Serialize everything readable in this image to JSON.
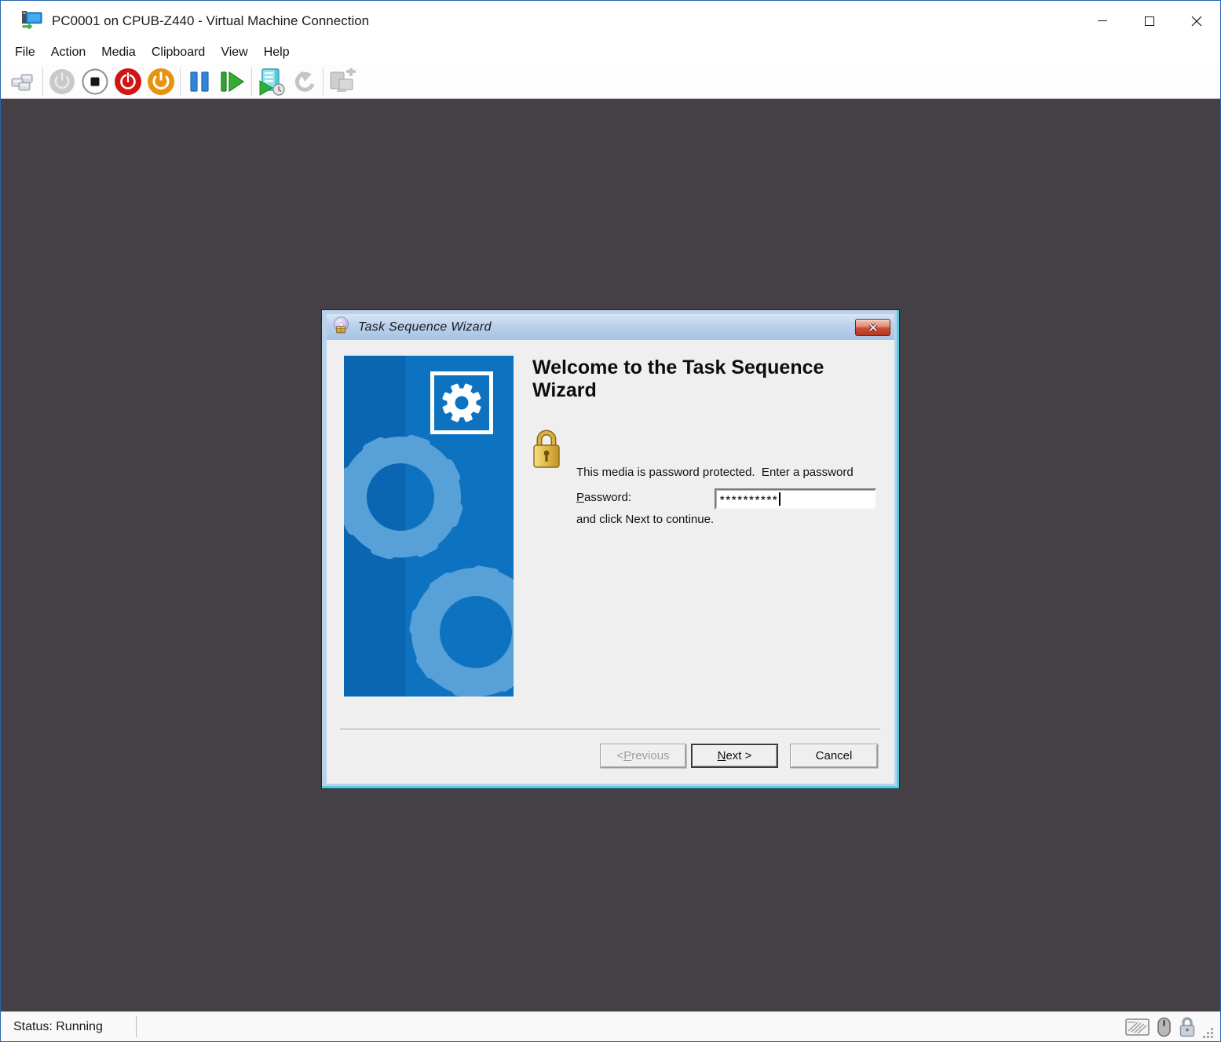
{
  "window": {
    "title": "PC0001 on CPUB-Z440 - Virtual Machine Connection"
  },
  "menu": {
    "items": [
      "File",
      "Action",
      "Media",
      "Clipboard",
      "View",
      "Help"
    ]
  },
  "toolbar": {
    "icons": [
      "ctrl-alt-del",
      "start",
      "stop",
      "turn-off",
      "shut-down",
      "pause",
      "reset",
      "checkpoint",
      "revert",
      "enhanced-session"
    ]
  },
  "vm_dialog": {
    "title": "Task Sequence Wizard",
    "heading": "Welcome to the Task Sequence Wizard",
    "message_line1": "This media is password protected.  Enter a password",
    "message_line2": "and click Next to continue.",
    "password": {
      "label_mnemonic": "P",
      "label_rest": "assword:",
      "value": "**********"
    },
    "buttons": {
      "previous": {
        "prefix": "< ",
        "mnemonic": "P",
        "suffix": "revious"
      },
      "next": {
        "prefix": "",
        "mnemonic": "N",
        "suffix": "ext >"
      },
      "cancel": {
        "label": "Cancel"
      }
    }
  },
  "status_bar": {
    "text": "Status: Running",
    "icons": [
      "keyboard",
      "mouse",
      "lock"
    ]
  },
  "colors": {
    "window_border": "#2766b1",
    "vm_background": "#454045",
    "dialog_frame": "#bad1ea",
    "panel_blue_dark": "#0a66b0",
    "panel_blue": "#0d73c1",
    "gear_blue": "#57a0d8",
    "close_button_red": "#cd4c34",
    "toolbar_red": "#d11515",
    "toolbar_orange": "#e8930f",
    "toolbar_pause_blue": "#3583d6",
    "toolbar_green": "#31a431"
  }
}
